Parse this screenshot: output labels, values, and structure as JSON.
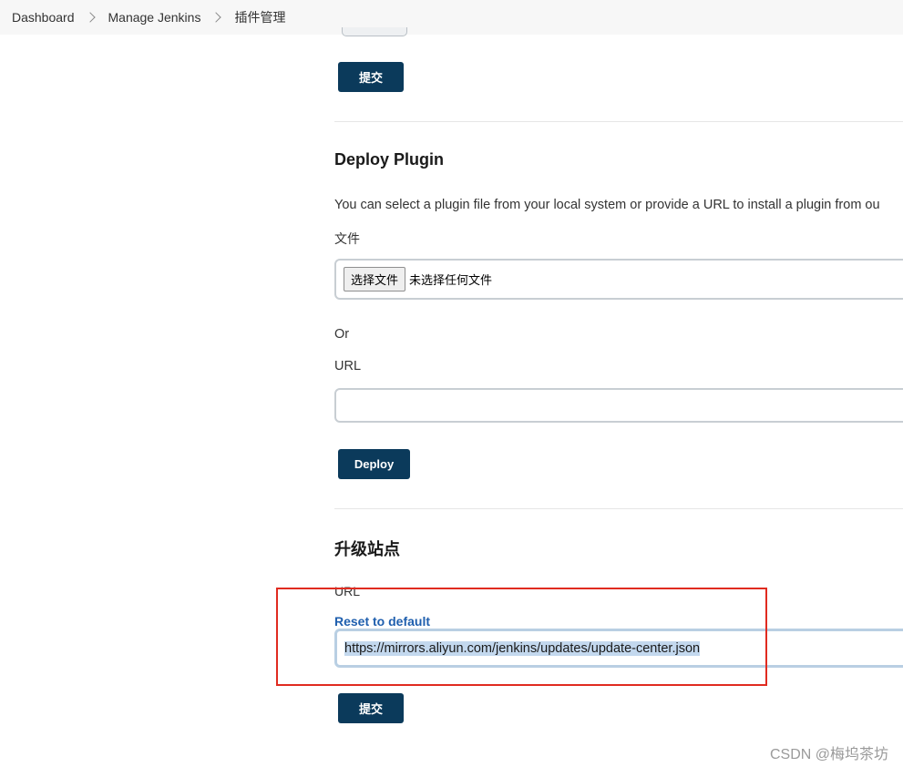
{
  "breadcrumb": {
    "items": [
      "Dashboard",
      "Manage Jenkins",
      "插件管理"
    ]
  },
  "top": {
    "submit_label": "提交"
  },
  "deploy_plugin": {
    "title": "Deploy Plugin",
    "description": "You can select a plugin file from your local system or provide a URL to install a plugin from ou",
    "file_label": "文件",
    "file_button": "选择文件",
    "file_status": "未选择任何文件",
    "or_label": "Or",
    "url_label": "URL",
    "url_value": "",
    "deploy_label": "Deploy"
  },
  "update_site": {
    "title": "升级站点",
    "url_label": "URL",
    "reset_label": "Reset to default",
    "url_value": "https://mirrors.aliyun.com/jenkins/updates/update-center.json",
    "submit_label": "提交"
  },
  "watermark": "CSDN @梅坞茶坊",
  "colors": {
    "button_bg": "#0b3a5b",
    "link": "#1f5fae",
    "annotation": "#e02b20",
    "selection": "#c3d8ee"
  }
}
